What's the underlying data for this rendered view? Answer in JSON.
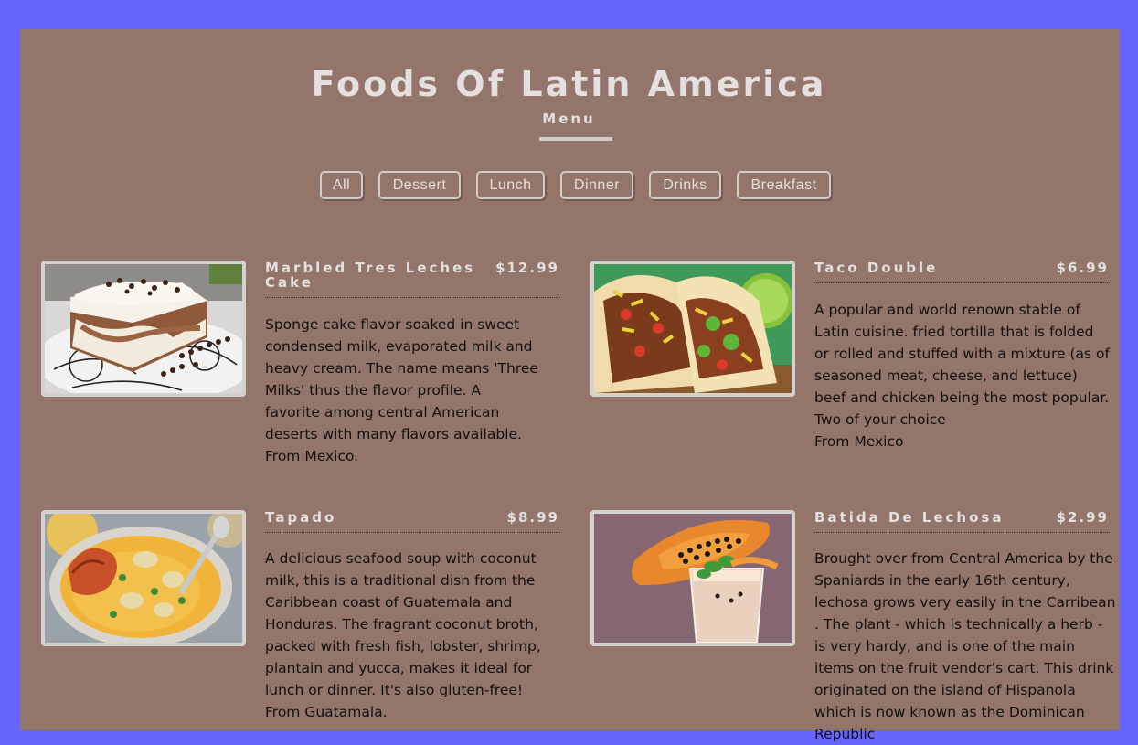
{
  "header": {
    "title": "Foods Of Latin America",
    "subtitle": "Menu"
  },
  "filters": [
    "All",
    "Dessert",
    "Lunch",
    "Dinner",
    "Drinks",
    "Breakfast"
  ],
  "colors": {
    "page_background": "#6666ff",
    "panel_background": "#94756b",
    "heading_text": "#e4e0e0",
    "body_text": "#141010"
  },
  "menu": [
    {
      "name": "Marbled Tres Leches Cake",
      "price": "$12.99",
      "image": "tres-leches-cake-photo",
      "description": "Sponge cake flavor soaked in sweet condensed milk, evaporated milk and heavy cream. The name means 'Three Milks' thus the flavor profile. A favorite among central American deserts with many flavors available.",
      "origin": "From Mexico."
    },
    {
      "name": "Taco Double",
      "price": "$6.99",
      "image": "tacos-photo",
      "description": "A popular and world renown stable of Latin cuisine. fried tortilla that is folded or rolled and stuffed with a mixture (as of seasoned meat, cheese, and lettuce) beef and chicken being the most popular. Two of your choice",
      "origin": "From Mexico"
    },
    {
      "name": "Tapado",
      "price": "$8.99",
      "image": "seafood-soup-photo",
      "description": "A delicious seafood soup with coconut milk, this is a traditional dish from the Caribbean coast of Guatemala and Honduras. The fragrant coconut broth, packed with fresh fish, lobster, shrimp, plantain and yucca, makes it ideal for lunch or dinner. It's also gluten-free!",
      "origin": "From Guatamala."
    },
    {
      "name": "Batida De Lechosa",
      "price": "$2.99",
      "image": "papaya-smoothie-photo",
      "description": "Brought over from Central America by the Spaniards in the early 16th century, lechosa grows very easily in the Carribean . The plant - which is technically a herb - is very hardy, and is one of the main items on the fruit vendor's cart. This drink originated on the island of Hispanola which is now known as the Dominican Republic",
      "origin": ""
    }
  ]
}
